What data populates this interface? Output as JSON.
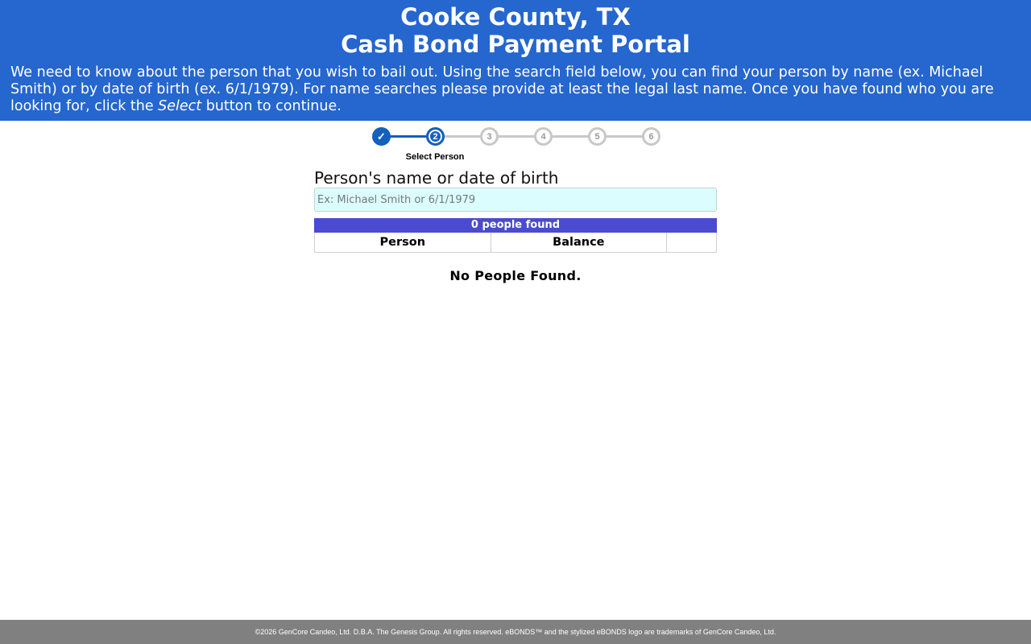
{
  "header": {
    "title_line1": "Cooke County, TX",
    "title_line2": "Cash Bond Payment Portal",
    "intro_before": "We need to know about the person that you wish to bail out. Using the search field below, you can find your person by name (ex. Michael Smith) or by date of birth (ex. 6/1/1979). For name searches please provide at least the legal last name. Once you have found who you are looking for, click the ",
    "intro_emphasis": "Select",
    "intro_after": " button to continue."
  },
  "stepper": {
    "steps": [
      {
        "label": "✓",
        "state": "complete"
      },
      {
        "label": "2",
        "state": "current"
      },
      {
        "label": "3",
        "state": "pending"
      },
      {
        "label": "4",
        "state": "pending"
      },
      {
        "label": "5",
        "state": "pending"
      },
      {
        "label": "6",
        "state": "pending"
      }
    ],
    "current_label": "Select Person"
  },
  "search": {
    "label": "Person's name or date of birth",
    "placeholder": "Ex: Michael Smith or 6/1/1979",
    "value": ""
  },
  "results": {
    "count_text": "0 people found",
    "columns": [
      "Person",
      "Balance",
      ""
    ],
    "empty_text": "No People Found."
  },
  "footer": {
    "text": "©2026 GenCore Candeo, Ltd. D.B.A. The Genesis Group. All rights reserved. eBONDS™ and the stylized eBONDS logo are trademarks of GenCore Candeo, Ltd."
  },
  "colors": {
    "header_bg": "#2566cf",
    "step_active": "#1560bd",
    "step_pending": "#c8c8c8",
    "results_bar": "#4b4bcf",
    "input_bg": "#dcfdfd",
    "footer_bg": "#808080"
  }
}
